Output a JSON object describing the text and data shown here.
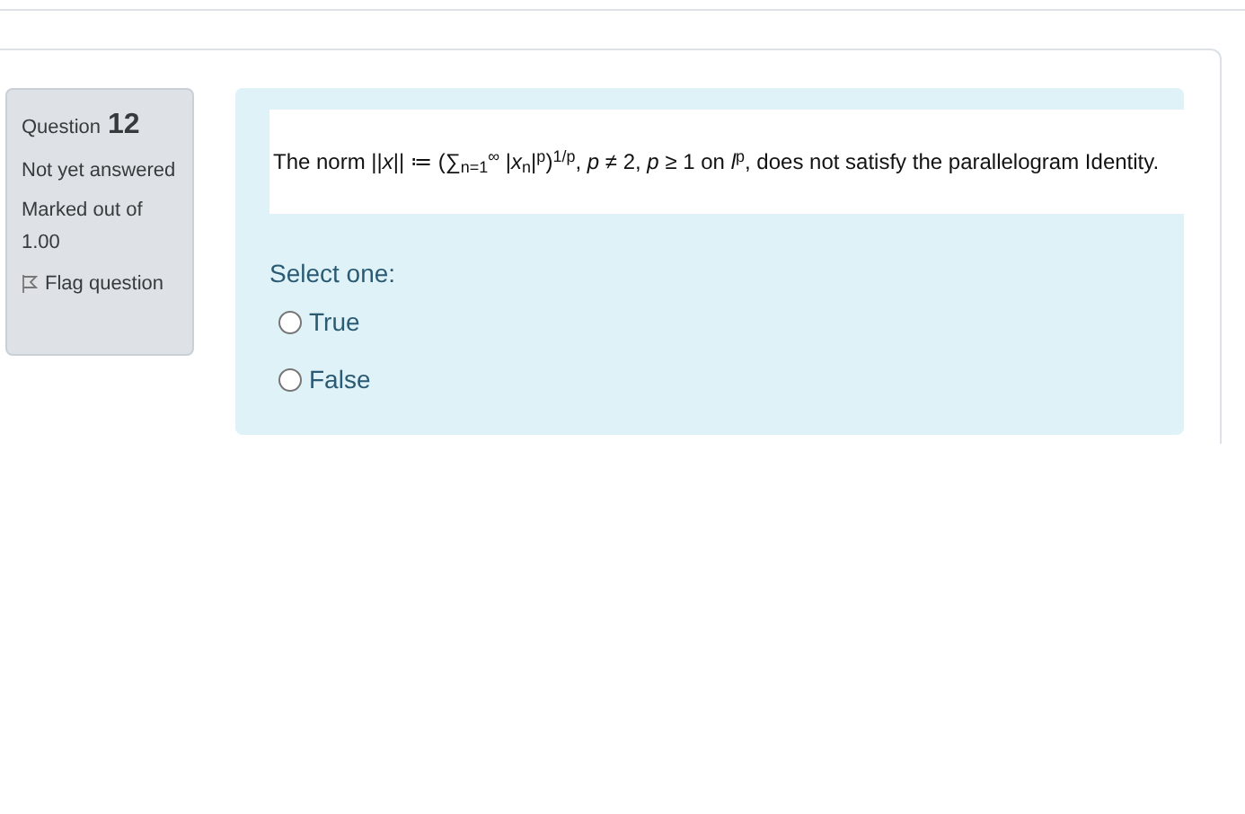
{
  "question_info": {
    "label": "Question",
    "number": "12",
    "status": "Not yet answered",
    "marks": "Marked out of 1.00",
    "flag": {
      "label": "Flag question",
      "flagged": false
    }
  },
  "question": {
    "text": "The norm ||*x*|| ≔ (∑$_{n=1}$$^{∞}$ |*x*$_{n}$|$^{p}$)$^{1/p}$, *p* ≠ 2, *p* ≥ 1 on *l*$^{p}$,  does not satisfy the parallelogram Identity.",
    "prompt": "Select one:",
    "options": [
      {
        "label": "True",
        "selected": false
      },
      {
        "label": "False",
        "selected": false
      }
    ]
  }
}
